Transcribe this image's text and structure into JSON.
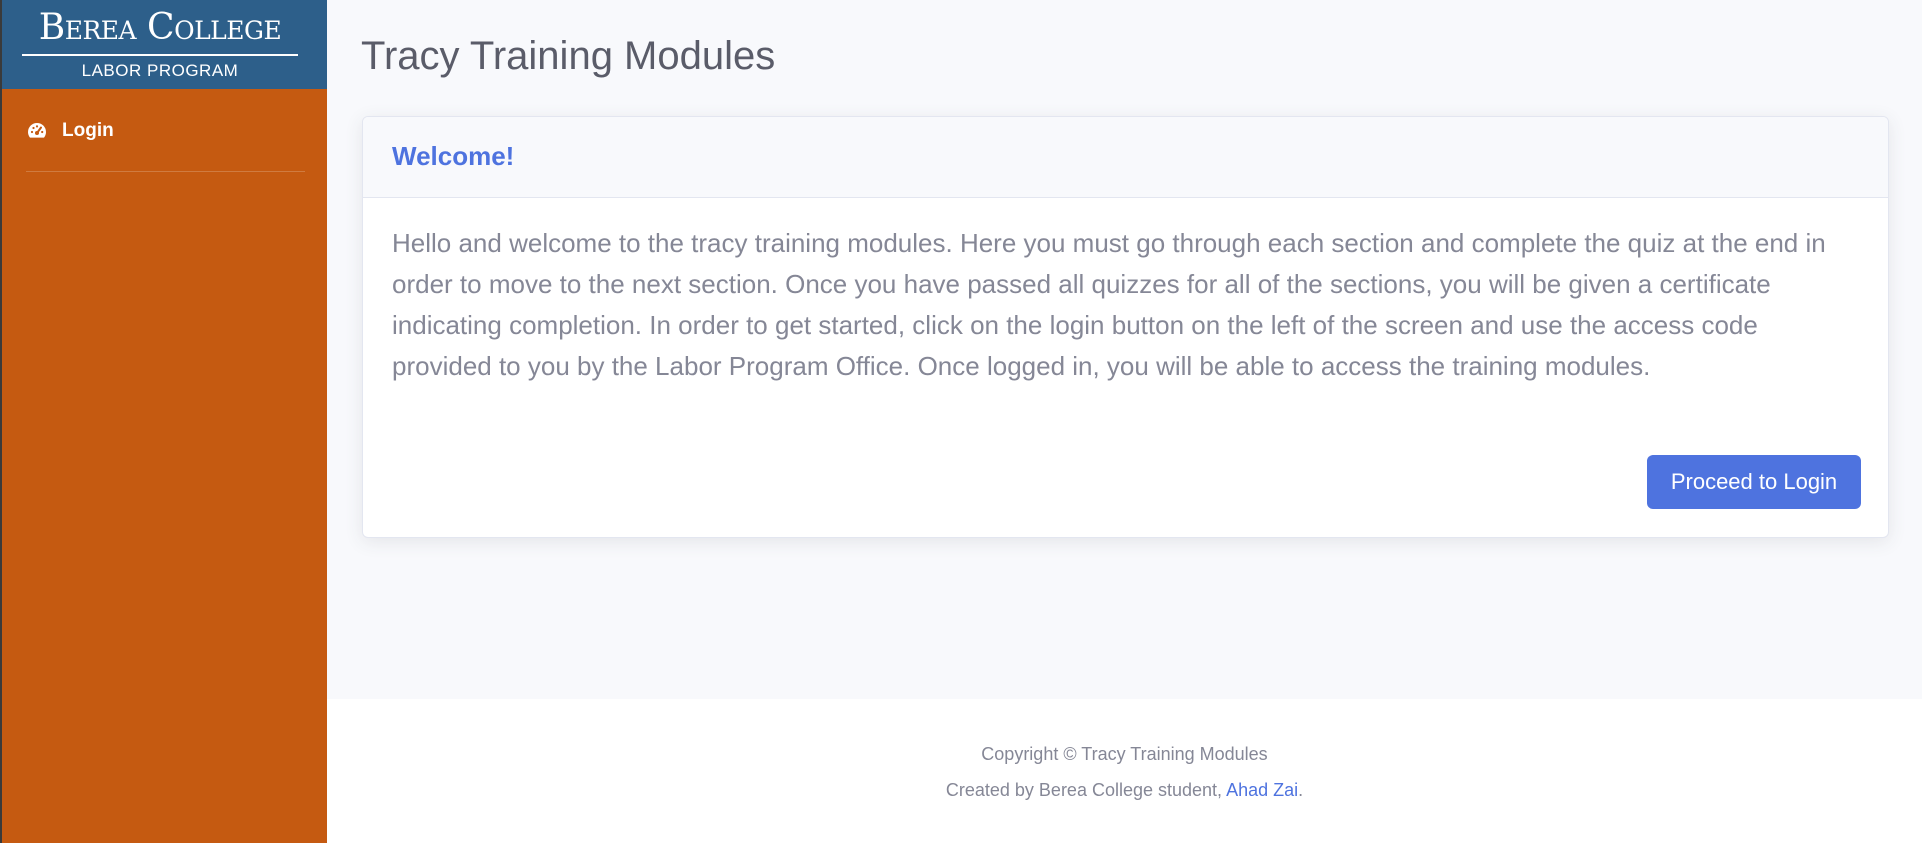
{
  "sidebar": {
    "brand": {
      "name": "Berea College",
      "subtitle": "LABOR PROGRAM"
    },
    "nav": [
      {
        "label": "Login",
        "icon": "tachometer-icon"
      }
    ]
  },
  "page": {
    "title": "Tracy Training Modules"
  },
  "card": {
    "title": "Welcome!",
    "body": "Hello and welcome to the tracy training modules. Here you must go through each section and complete the quiz at the end in order to move to the next section. Once you have passed all quizzes for all of the sections, you will be given a certificate indicating completion. In order to get started, click on the login button on the left of the screen and use the access code provided to you by the Labor Program Office. Once logged in, you will be able to access the training modules.",
    "button_label": "Proceed to Login"
  },
  "footer": {
    "copyright": "Copyright © Tracy Training Modules",
    "created_by_prefix": "Created by Berea College student, ",
    "author": "Ahad Zai",
    "created_by_suffix": "."
  },
  "colors": {
    "sidebar_bg": "#c55a11",
    "brand_bg": "#2d5f8a",
    "primary": "#4e73df",
    "text_muted": "#858796",
    "title_text": "#5a5c69",
    "page_bg": "#f8f9fc"
  }
}
